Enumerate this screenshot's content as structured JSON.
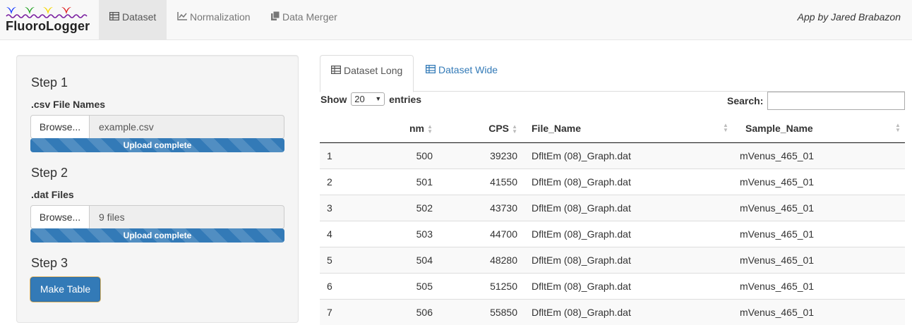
{
  "brand": {
    "name": "FluoroLogger",
    "logo_colors": [
      "#1a3cff",
      "#23a323",
      "#f5d800",
      "#e02020",
      "#7a1fa0"
    ]
  },
  "nav": {
    "items": [
      {
        "label": "Dataset",
        "icon": "table-icon",
        "active": true
      },
      {
        "label": "Normalization",
        "icon": "line-chart-icon",
        "active": false
      },
      {
        "label": "Data Merger",
        "icon": "files-icon",
        "active": false
      }
    ],
    "credit": "App by Jared Brabazon"
  },
  "sidebar": {
    "step1": {
      "title": "Step 1",
      "label": ".csv File Names",
      "browse": "Browse...",
      "file": "example.csv",
      "progress": "Upload complete",
      "progress_value": 1.0
    },
    "step2": {
      "title": "Step 2",
      "label": ".dat Files",
      "browse": "Browse...",
      "file": "9 files",
      "progress": "Upload complete",
      "progress_value": 1.0
    },
    "step3": {
      "title": "Step 3",
      "button": "Make Table"
    }
  },
  "tabs": [
    {
      "label": "Dataset Long",
      "icon": "table-icon",
      "active": true
    },
    {
      "label": "Dataset Wide",
      "icon": "table-icon",
      "active": false
    }
  ],
  "table_controls": {
    "show": "Show",
    "page_size": "20",
    "entries": "entries",
    "search_label": "Search:",
    "search_value": ""
  },
  "table": {
    "columns": [
      "",
      "nm",
      "CPS",
      "File_Name",
      "Sample_Name"
    ],
    "rows": [
      [
        "1",
        "500",
        "39230",
        "DfltEm (08)_Graph.dat",
        "mVenus_465_01"
      ],
      [
        "2",
        "501",
        "41550",
        "DfltEm (08)_Graph.dat",
        "mVenus_465_01"
      ],
      [
        "3",
        "502",
        "43730",
        "DfltEm (08)_Graph.dat",
        "mVenus_465_01"
      ],
      [
        "4",
        "503",
        "44700",
        "DfltEm (08)_Graph.dat",
        "mVenus_465_01"
      ],
      [
        "5",
        "504",
        "48280",
        "DfltEm (08)_Graph.dat",
        "mVenus_465_01"
      ],
      [
        "6",
        "505",
        "51250",
        "DfltEm (08)_Graph.dat",
        "mVenus_465_01"
      ],
      [
        "7",
        "506",
        "55850",
        "DfltEm (08)_Graph.dat",
        "mVenus_465_01"
      ]
    ]
  }
}
